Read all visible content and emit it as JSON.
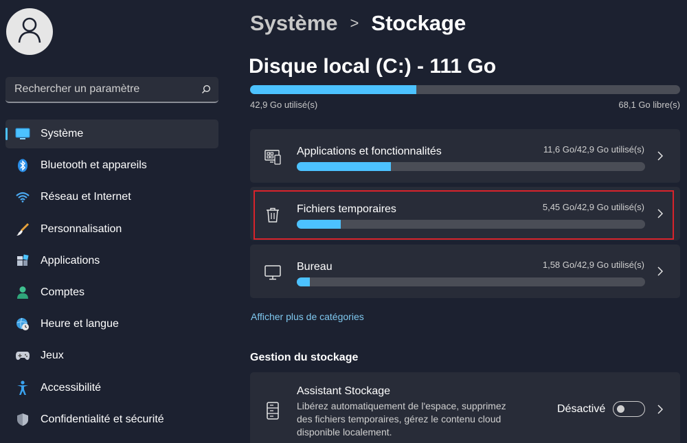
{
  "sidebar": {
    "search": {
      "placeholder": "Rechercher un paramètre"
    },
    "items": [
      {
        "label": "Système",
        "icon": "monitor-icon",
        "active": true
      },
      {
        "label": "Bluetooth et appareils",
        "icon": "bluetooth-icon"
      },
      {
        "label": "Réseau et Internet",
        "icon": "wifi-icon"
      },
      {
        "label": "Personnalisation",
        "icon": "paintbrush-icon"
      },
      {
        "label": "Applications",
        "icon": "apps-icon"
      },
      {
        "label": "Comptes",
        "icon": "person-icon"
      },
      {
        "label": "Heure et langue",
        "icon": "globe-clock-icon"
      },
      {
        "label": "Jeux",
        "icon": "gamepad-icon"
      },
      {
        "label": "Accessibilité",
        "icon": "accessibility-icon"
      },
      {
        "label": "Confidentialité et sécurité",
        "icon": "shield-icon"
      }
    ]
  },
  "header": {
    "breadcrumb_parent": "Système",
    "breadcrumb_separator": ">",
    "breadcrumb_current": "Stockage"
  },
  "disk": {
    "title": "Disque local (C:) - 111 Go",
    "used_label": "42,9 Go utilisé(s)",
    "free_label": "68,1 Go libre(s)",
    "used_fraction": 0.386
  },
  "categories": [
    {
      "title": "Applications et fonctionnalités",
      "stat": "11,6 Go/42,9 Go utilisé(s)",
      "fraction": 0.27,
      "icon": "apps-features-icon"
    },
    {
      "title": "Fichiers temporaires",
      "stat": "5,45 Go/42,9 Go utilisé(s)",
      "fraction": 0.127,
      "icon": "trash-icon",
      "highlighted": true
    },
    {
      "title": "Bureau",
      "stat": "1,58 Go/42,9 Go utilisé(s)",
      "fraction": 0.037,
      "icon": "desktop-icon"
    }
  ],
  "more_link": "Afficher plus de catégories",
  "management": {
    "title": "Gestion du stockage",
    "storage_sense": {
      "title": "Assistant Stockage",
      "description": "Libérez automatiquement de l'espace, supprimez des fichiers temporaires, gérez le contenu cloud disponible localement.",
      "state_label": "Désactivé",
      "enabled": false
    }
  },
  "colors": {
    "background": "#1c2130",
    "card": "#282c38",
    "accent": "#4cc2ff",
    "highlight_border": "#d9232b",
    "link": "#7fc8ef"
  }
}
